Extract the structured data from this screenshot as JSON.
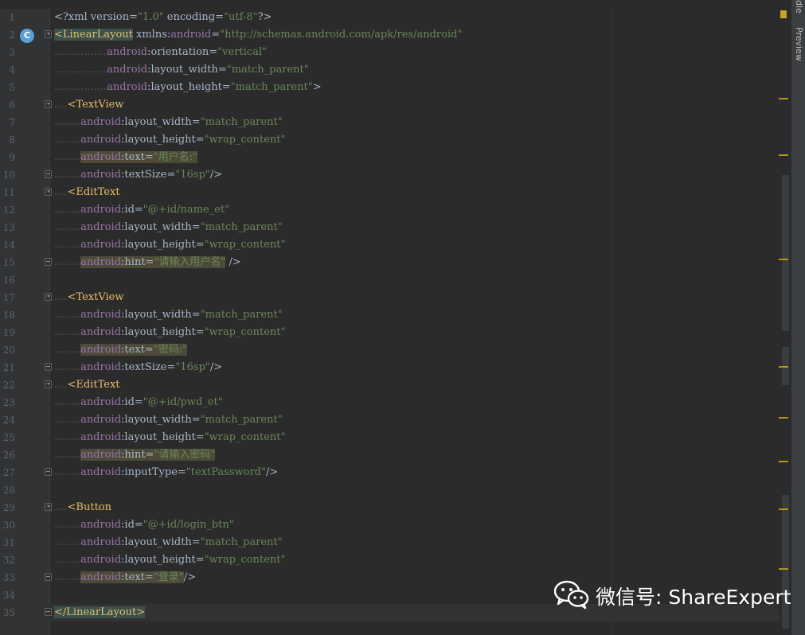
{
  "editor": {
    "lines": [
      {
        "n": "1",
        "tokens": [
          [
            "c-plain",
            "<?xml version="
          ],
          [
            "c-str",
            "\"1.0\""
          ],
          [
            "c-plain",
            " encoding="
          ],
          [
            "c-str",
            "\"utf-8\""
          ],
          [
            "c-plain",
            "?>"
          ]
        ]
      },
      {
        "n": "2",
        "marker": "C",
        "fold": "open",
        "tokens": [
          [
            "c-tag hl-tag",
            "<LinearLayout"
          ],
          [
            "c-plain",
            " xmlns:"
          ],
          [
            "c-ns",
            "android"
          ],
          [
            "c-plain",
            "="
          ],
          [
            "c-str",
            "\"http://schemas.android.com/apk/res/android\""
          ]
        ]
      },
      {
        "n": "3",
        "tokens": [
          [
            "ws",
            "................"
          ],
          [
            "c-ns",
            "android"
          ],
          [
            "c-plain",
            ":orientation="
          ],
          [
            "c-str",
            "\"vertical\""
          ]
        ]
      },
      {
        "n": "4",
        "tokens": [
          [
            "ws",
            "................"
          ],
          [
            "c-ns",
            "android"
          ],
          [
            "c-plain",
            ":layout_width="
          ],
          [
            "c-str",
            "\"match_parent\""
          ]
        ]
      },
      {
        "n": "5",
        "tokens": [
          [
            "ws",
            "................"
          ],
          [
            "c-ns",
            "android"
          ],
          [
            "c-plain",
            ":layout_height="
          ],
          [
            "c-str",
            "\"match_parent\""
          ],
          [
            "c-plain",
            ">"
          ]
        ]
      },
      {
        "n": "6",
        "fold": "open",
        "tokens": [
          [
            "ws",
            "...."
          ],
          [
            "c-tag",
            "<TextView"
          ]
        ]
      },
      {
        "n": "7",
        "tokens": [
          [
            "ws",
            "........"
          ],
          [
            "c-ns",
            "android"
          ],
          [
            "c-plain",
            ":layout_width="
          ],
          [
            "c-str",
            "\"match_parent\""
          ]
        ]
      },
      {
        "n": "8",
        "tokens": [
          [
            "ws",
            "........"
          ],
          [
            "c-ns",
            "android"
          ],
          [
            "c-plain",
            ":layout_height="
          ],
          [
            "c-str",
            "\"wrap_content\""
          ]
        ]
      },
      {
        "n": "9",
        "tokens": [
          [
            "ws",
            "........"
          ],
          [
            "c-ns hl-all",
            "android"
          ],
          [
            "c-plain hl-all",
            ":text="
          ],
          [
            "c-str hl-all",
            "\"用户名:\""
          ]
        ]
      },
      {
        "n": "10",
        "fold": "close",
        "tokens": [
          [
            "ws",
            "........"
          ],
          [
            "c-ns",
            "android"
          ],
          [
            "c-plain",
            ":textSize="
          ],
          [
            "c-str",
            "\"16sp\""
          ],
          [
            "c-plain",
            "/>"
          ]
        ]
      },
      {
        "n": "11",
        "fold": "open",
        "tokens": [
          [
            "ws",
            "...."
          ],
          [
            "c-tag",
            "<EditText"
          ]
        ]
      },
      {
        "n": "12",
        "tokens": [
          [
            "ws",
            "........"
          ],
          [
            "c-ns",
            "android"
          ],
          [
            "c-plain",
            ":id="
          ],
          [
            "c-str",
            "\"@+id/name_et\""
          ]
        ]
      },
      {
        "n": "13",
        "tokens": [
          [
            "ws",
            "........"
          ],
          [
            "c-ns",
            "android"
          ],
          [
            "c-plain",
            ":layout_width="
          ],
          [
            "c-str",
            "\"match_parent\""
          ]
        ]
      },
      {
        "n": "14",
        "tokens": [
          [
            "ws",
            "........"
          ],
          [
            "c-ns",
            "android"
          ],
          [
            "c-plain",
            ":layout_height="
          ],
          [
            "c-str",
            "\"wrap_content\""
          ]
        ]
      },
      {
        "n": "15",
        "fold": "close",
        "tokens": [
          [
            "ws",
            "........"
          ],
          [
            "c-ns hl-all",
            "android"
          ],
          [
            "c-plain hl-all",
            ":hint="
          ],
          [
            "c-str hl-all",
            "\"请输入用户名\""
          ],
          [
            "c-plain",
            " />"
          ]
        ]
      },
      {
        "n": "16",
        "tokens": []
      },
      {
        "n": "17",
        "fold": "open",
        "tokens": [
          [
            "ws",
            "...."
          ],
          [
            "c-tag",
            "<TextView"
          ]
        ]
      },
      {
        "n": "18",
        "tokens": [
          [
            "ws",
            "........"
          ],
          [
            "c-ns",
            "android"
          ],
          [
            "c-plain",
            ":layout_width="
          ],
          [
            "c-str",
            "\"match_parent\""
          ]
        ]
      },
      {
        "n": "19",
        "tokens": [
          [
            "ws",
            "........"
          ],
          [
            "c-ns",
            "android"
          ],
          [
            "c-plain",
            ":layout_height="
          ],
          [
            "c-str",
            "\"wrap_content\""
          ]
        ]
      },
      {
        "n": "20",
        "tokens": [
          [
            "ws",
            "........"
          ],
          [
            "c-ns hl-all",
            "android"
          ],
          [
            "c-plain hl-all",
            ":text="
          ],
          [
            "c-str hl-all",
            "\"密码:\""
          ]
        ]
      },
      {
        "n": "21",
        "fold": "close",
        "tokens": [
          [
            "ws",
            "........"
          ],
          [
            "c-ns",
            "android"
          ],
          [
            "c-plain",
            ":textSize="
          ],
          [
            "c-str",
            "\"16sp\""
          ],
          [
            "c-plain",
            "/>"
          ]
        ]
      },
      {
        "n": "22",
        "fold": "open",
        "tokens": [
          [
            "ws",
            "...."
          ],
          [
            "c-tag",
            "<EditText"
          ]
        ]
      },
      {
        "n": "23",
        "tokens": [
          [
            "ws",
            "........"
          ],
          [
            "c-ns",
            "android"
          ],
          [
            "c-plain",
            ":id="
          ],
          [
            "c-str",
            "\"@+id/pwd_et\""
          ]
        ]
      },
      {
        "n": "24",
        "tokens": [
          [
            "ws",
            "........"
          ],
          [
            "c-ns",
            "android"
          ],
          [
            "c-plain",
            ":layout_width="
          ],
          [
            "c-str",
            "\"match_parent\""
          ]
        ]
      },
      {
        "n": "25",
        "tokens": [
          [
            "ws",
            "........"
          ],
          [
            "c-ns",
            "android"
          ],
          [
            "c-plain",
            ":layout_height="
          ],
          [
            "c-str",
            "\"wrap_content\""
          ]
        ]
      },
      {
        "n": "26",
        "tokens": [
          [
            "ws",
            "........"
          ],
          [
            "c-ns hl-all",
            "android"
          ],
          [
            "c-plain hl-all",
            ":hint="
          ],
          [
            "c-str hl-all",
            "\"请输入密码\""
          ]
        ]
      },
      {
        "n": "27",
        "fold": "close",
        "tokens": [
          [
            "ws",
            "........"
          ],
          [
            "c-ns",
            "android"
          ],
          [
            "c-plain",
            ":inputType="
          ],
          [
            "c-str",
            "\"textPassword\""
          ],
          [
            "c-plain",
            "/>"
          ]
        ]
      },
      {
        "n": "28",
        "tokens": []
      },
      {
        "n": "29",
        "fold": "open",
        "tokens": [
          [
            "ws",
            "...."
          ],
          [
            "c-tag",
            "<Button"
          ]
        ]
      },
      {
        "n": "30",
        "tokens": [
          [
            "ws",
            "........"
          ],
          [
            "c-ns",
            "android"
          ],
          [
            "c-plain",
            ":id="
          ],
          [
            "c-str",
            "\"@+id/login_btn\""
          ]
        ]
      },
      {
        "n": "31",
        "tokens": [
          [
            "ws",
            "........"
          ],
          [
            "c-ns",
            "android"
          ],
          [
            "c-plain",
            ":layout_width="
          ],
          [
            "c-str",
            "\"match_parent\""
          ]
        ]
      },
      {
        "n": "32",
        "tokens": [
          [
            "ws",
            "........"
          ],
          [
            "c-ns",
            "android"
          ],
          [
            "c-plain",
            ":layout_height="
          ],
          [
            "c-str",
            "\"wrap_content\""
          ]
        ]
      },
      {
        "n": "33",
        "fold": "close",
        "tokens": [
          [
            "ws",
            "........"
          ],
          [
            "c-ns hl-all",
            "android"
          ],
          [
            "c-plain hl-all",
            ":text="
          ],
          [
            "c-str hl-all",
            "\"登录\""
          ],
          [
            "c-plain",
            "/>"
          ]
        ]
      },
      {
        "n": "34",
        "tokens": []
      },
      {
        "n": "35",
        "fold": "close",
        "current": true,
        "tokens": [
          [
            "c-tag hl-tag",
            "</LinearLayout>"
          ]
        ]
      }
    ]
  },
  "side_tabs": {
    "gradle": "dle",
    "preview": "Preview"
  },
  "watermark": {
    "text": "微信号: ShareExpert"
  },
  "colors": {
    "background": "#2b2b2b",
    "gutter": "#313335",
    "tag": "#e8bf6a",
    "namespace": "#9876aa",
    "string": "#6a8759",
    "marker": "#5aa0d8",
    "stripe_mark": "#be9117"
  },
  "icons": {
    "gutter_marker": "class-marker-icon",
    "watermark_logo": "wechat-icon",
    "analysis": "analysis-status-icon"
  }
}
